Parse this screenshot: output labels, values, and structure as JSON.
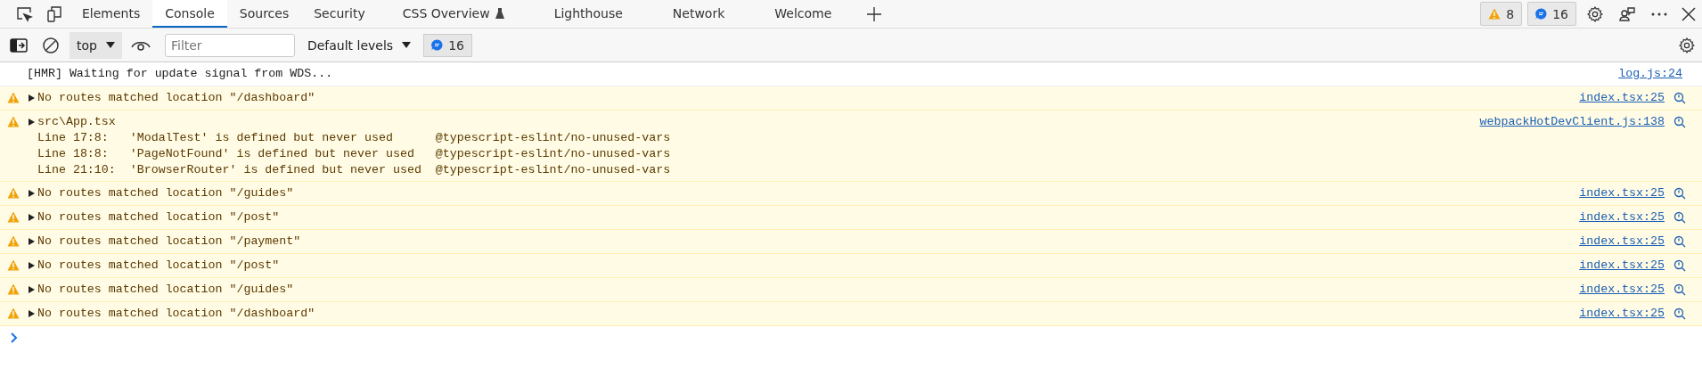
{
  "tabs": [
    {
      "label": "Elements",
      "selected": false
    },
    {
      "label": "Console",
      "selected": true
    },
    {
      "label": "Sources",
      "selected": false
    },
    {
      "label": "Security",
      "selected": false
    },
    {
      "label": "CSS Overview",
      "selected": false,
      "kind": "experimental"
    },
    {
      "label": "Lighthouse",
      "selected": false
    },
    {
      "label": "Network",
      "selected": false
    },
    {
      "label": "Welcome",
      "selected": false
    }
  ],
  "counters": [
    {
      "kind": "warning",
      "count": "8"
    },
    {
      "kind": "info",
      "count": "16"
    }
  ],
  "toolbar": {
    "context": "top",
    "filter": {
      "placeholder": "Filter"
    },
    "levels": "Default levels",
    "message_count": "16"
  },
  "messages": [
    {
      "kind": "log",
      "text": "[HMR] Waiting for update signal from WDS...",
      "source": "log.js:24"
    },
    {
      "kind": "warning",
      "expanded": false,
      "text": "No routes matched location \"/dashboard\"",
      "source": "index.tsx:25"
    },
    {
      "kind": "warning",
      "expanded": false,
      "text": "src\\App.tsx",
      "lines": [
        "Line 17:8:   'ModalTest' is defined but never used      @typescript-eslint/no-unused-vars",
        "Line 18:8:   'PageNotFound' is defined but never used   @typescript-eslint/no-unused-vars",
        "Line 21:10:  'BrowserRouter' is defined but never used  @typescript-eslint/no-unused-vars"
      ],
      "source": "webpackHotDevClient.js:138"
    },
    {
      "kind": "warning",
      "expanded": false,
      "text": "No routes matched location \"/guides\"",
      "source": "index.tsx:25"
    },
    {
      "kind": "warning",
      "expanded": false,
      "text": "No routes matched location \"/post\"",
      "source": "index.tsx:25"
    },
    {
      "kind": "warning",
      "expanded": false,
      "text": "No routes matched location \"/payment\"",
      "source": "index.tsx:25"
    },
    {
      "kind": "warning",
      "expanded": false,
      "text": "No routes matched location \"/post\"",
      "source": "index.tsx:25"
    },
    {
      "kind": "warning",
      "expanded": false,
      "text": "No routes matched location \"/guides\"",
      "source": "index.tsx:25"
    },
    {
      "kind": "warning",
      "expanded": false,
      "text": "No routes matched location \"/dashboard\"",
      "source": "index.tsx:25"
    }
  ]
}
